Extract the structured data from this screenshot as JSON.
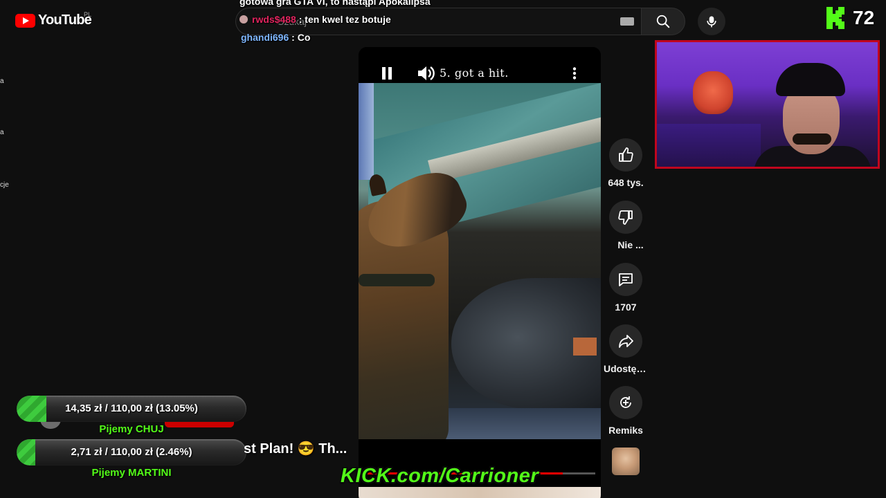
{
  "youtube": {
    "logo_text": "YouTube",
    "region": "PL",
    "sidebar_fragments": [
      "a",
      "a",
      "cje"
    ],
    "search_placeholder": "Szukaj"
  },
  "chat": {
    "top_message": "gotowa gra GTA VI, to nastąpi Apokalipsa",
    "messages": [
      {
        "user": "rwds$488",
        "separator": ":",
        "text": "ten kwel tez botuje"
      },
      {
        "user": "ghandi696",
        "separator": ":",
        "text": "Co"
      }
    ]
  },
  "kick": {
    "viewer_count": "72",
    "url_text": "KICK.com/Carrioner",
    "brand_color": "#53fc18"
  },
  "short": {
    "title": "5. got a hit.",
    "controls": [
      "pause-icon",
      "volume-icon",
      "more-vert-icon"
    ],
    "progress_fraction": 0.86
  },
  "actions": [
    {
      "name": "like",
      "icon": "thumb-up-icon",
      "label": "648 tys."
    },
    {
      "name": "dislike",
      "icon": "thumb-down-icon",
      "label": "Nie ..."
    },
    {
      "name": "comments",
      "icon": "comment-icon",
      "label": "1707"
    },
    {
      "name": "share",
      "icon": "share-icon",
      "label": "Udostęp..."
    },
    {
      "name": "remix",
      "icon": "remix-icon",
      "label": "Remiks"
    }
  ],
  "goals": [
    {
      "text": "14,35 zł / 110,00 zł (13.05%)",
      "name": "Pijemy CHUJ",
      "progress": 0.1305
    },
    {
      "text": "2,71 zł / 110,00 zł (2.46%)",
      "name": "Pijemy MARTINI",
      "progress": 0.0246
    }
  ],
  "ticker_text": "st Plan! 😎 Th..."
}
